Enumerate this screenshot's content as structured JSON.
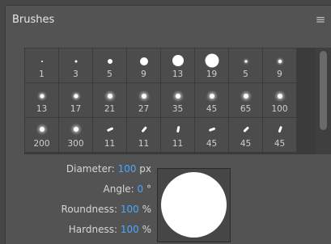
{
  "panel": {
    "title": "Brushes",
    "menu_icon": "hamburger-menu-icon"
  },
  "brushes": [
    {
      "size": "1",
      "shape": "hard-dot",
      "soft": false
    },
    {
      "size": "3",
      "shape": "hard-dot",
      "soft": false
    },
    {
      "size": "5",
      "shape": "hard-dot",
      "soft": false
    },
    {
      "size": "9",
      "shape": "hard-dot",
      "soft": false
    },
    {
      "size": "13",
      "shape": "hard-dot",
      "soft": false
    },
    {
      "size": "19",
      "shape": "hard-dot",
      "soft": false
    },
    {
      "size": "5",
      "shape": "soft-dot",
      "soft": true
    },
    {
      "size": "9",
      "shape": "soft-dot",
      "soft": true
    },
    {
      "size": "13",
      "shape": "soft-dot",
      "soft": true
    },
    {
      "size": "17",
      "shape": "soft-dot",
      "soft": true
    },
    {
      "size": "21",
      "shape": "soft-dot",
      "soft": true
    },
    {
      "size": "27",
      "shape": "soft-dot",
      "soft": true
    },
    {
      "size": "35",
      "shape": "soft-dot",
      "soft": true
    },
    {
      "size": "45",
      "shape": "soft-dot",
      "soft": true
    },
    {
      "size": "65",
      "shape": "soft-dot",
      "soft": true
    },
    {
      "size": "100",
      "shape": "soft-dot",
      "soft": true
    },
    {
      "size": "200",
      "shape": "soft-dot",
      "soft": true
    },
    {
      "size": "300",
      "shape": "soft-dot",
      "soft": true
    },
    {
      "size": "11",
      "shape": "angled-stroke",
      "soft": false
    },
    {
      "size": "11",
      "shape": "angled-stroke",
      "soft": false
    },
    {
      "size": "11",
      "shape": "angled-stroke",
      "soft": false
    },
    {
      "size": "45",
      "shape": "angled-stroke",
      "soft": false
    },
    {
      "size": "45",
      "shape": "angled-stroke",
      "soft": false
    },
    {
      "size": "45",
      "shape": "angled-stroke",
      "soft": false
    }
  ],
  "settings": {
    "diameter": {
      "label": "Diameter:",
      "value": "100",
      "unit": "px"
    },
    "angle": {
      "label": "Angle:",
      "value": "0",
      "unit": "°"
    },
    "roundness": {
      "label": "Roundness:",
      "value": "100",
      "unit": "%"
    },
    "hardness": {
      "label": "Hardness:",
      "value": "100",
      "unit": "%"
    }
  },
  "colors": {
    "value_accent": "#4aa8ff"
  }
}
